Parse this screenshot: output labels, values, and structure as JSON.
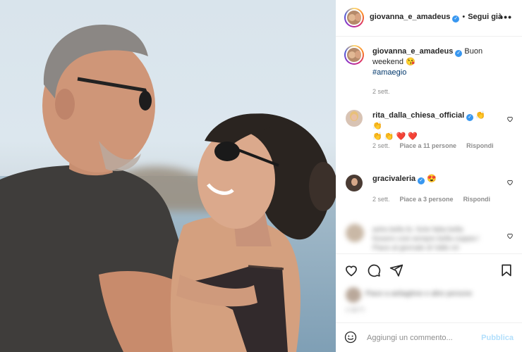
{
  "post": {
    "author": "giovanna_e_amadeus",
    "follow_label": "Segui già",
    "more_label": "•••",
    "caption_text": "Buon weekend",
    "caption_emoji": "😘",
    "hashtag": "#amaegio",
    "caption_time": "2 sett."
  },
  "comments": [
    {
      "user": "rita_dalla_chiesa_official",
      "emojis_line1": "👏 👏",
      "emojis_line2": "👏 👏 ❤️ ❤️",
      "time": "2 sett.",
      "likes": "Piace a 11 persone",
      "reply": "Rispondi"
    },
    {
      "user": "gracivaleria",
      "emojis_line1": "😍",
      "time": "2 sett.",
      "likes": "Piace a 3 persone",
      "reply": "Rispondi"
    }
  ],
  "blurred_comment": {
    "line1": "ashe.bello.fo. forte fatta bella",
    "line2": "fossero cosi sempre bella coppia l",
    "line3": "Piace al giornale di Valle ml"
  },
  "actions": {
    "like_icon": "heart-outline-icon",
    "comment_icon": "comment-icon",
    "share_icon": "paper-plane-icon",
    "save_icon": "bookmark-icon"
  },
  "likes_blurred": "Piace a aeliagtime e altre persone",
  "likes_time_blurred": "2 SETT.",
  "add_comment": {
    "placeholder": "Aggiungi un commento...",
    "publish_label": "Pubblica"
  },
  "colors": {
    "verified": "#3897f0",
    "hashtag": "#00376b",
    "publish_disabled": "#b2dffc",
    "meta_gray": "#8e8e8e"
  }
}
